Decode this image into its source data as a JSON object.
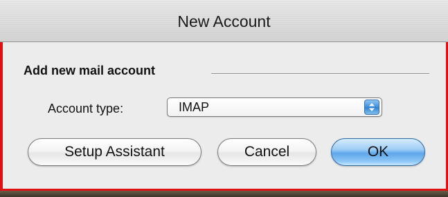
{
  "window": {
    "title": "New Account"
  },
  "section": {
    "header": "Add new mail account"
  },
  "account_type": {
    "label": "Account type:",
    "selected": "IMAP"
  },
  "buttons": {
    "setup_assistant": "Setup Assistant",
    "cancel": "Cancel",
    "ok": "OK"
  },
  "colors": {
    "highlight_border": "#e01010",
    "default_button": "#5ea7ea",
    "window_background": "#ececec"
  },
  "icons": {
    "select_arrows": "up-down-arrows-icon"
  }
}
